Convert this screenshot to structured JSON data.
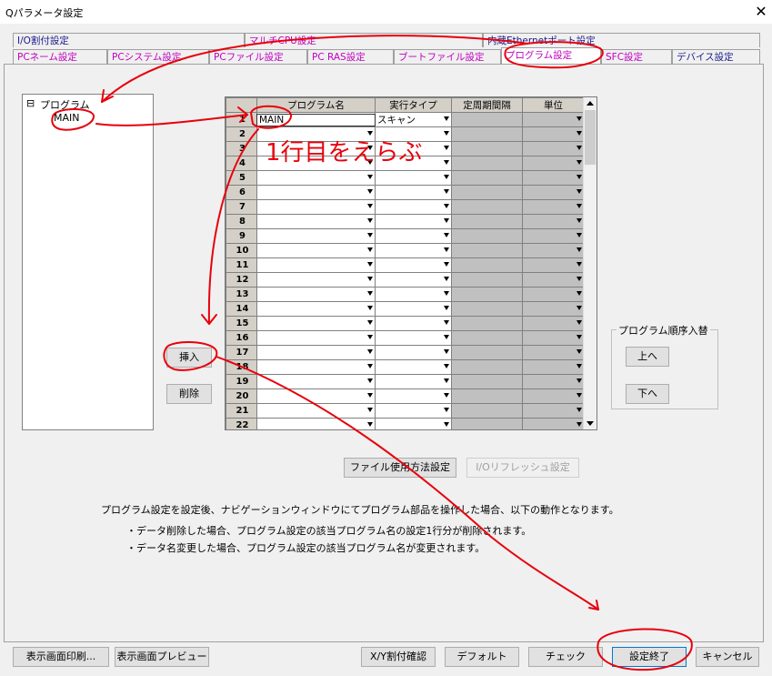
{
  "window": {
    "title": "Qパラメータ設定",
    "close_glyph": "✕"
  },
  "tabs_row1": [
    "I/O割付設定",
    "マルチCPU設定",
    "内蔵Ethernetポート設定"
  ],
  "tabs_row2": [
    "PCネーム設定",
    "PCシステム設定",
    "PCファイル設定",
    "PC RAS設定",
    "ブートファイル設定",
    "プログラム設定",
    "SFC設定",
    "デバイス設定"
  ],
  "tree": {
    "root_toggle": "⊟",
    "root": "プログラム",
    "child": "MAIN"
  },
  "buttons": {
    "insert": "挿入",
    "delete": "削除",
    "up": "上へ",
    "down": "下へ",
    "file_usage": "ファイル使用方法設定",
    "io_refresh": "I/Oリフレッシュ設定",
    "print": "表示画面印刷...",
    "preview": "表示画面プレビュー",
    "xy": "X/Y割付確認",
    "default": "デフォルト",
    "check": "チェック",
    "finish": "設定終了",
    "cancel": "キャンセル"
  },
  "order_group_label": "プログラム順序入替",
  "grid": {
    "headers": [
      "",
      "プログラム名",
      "実行タイプ",
      "定周期間隔",
      "単位"
    ],
    "rows": [
      {
        "num": "1",
        "name": "MAIN",
        "type": "スキャン"
      },
      {
        "num": "2",
        "name": "",
        "type": ""
      },
      {
        "num": "3",
        "name": "",
        "type": ""
      },
      {
        "num": "4",
        "name": "",
        "type": ""
      },
      {
        "num": "5",
        "name": "",
        "type": ""
      },
      {
        "num": "6",
        "name": "",
        "type": ""
      },
      {
        "num": "7",
        "name": "",
        "type": ""
      },
      {
        "num": "8",
        "name": "",
        "type": ""
      },
      {
        "num": "9",
        "name": "",
        "type": ""
      },
      {
        "num": "10",
        "name": "",
        "type": ""
      },
      {
        "num": "11",
        "name": "",
        "type": ""
      },
      {
        "num": "12",
        "name": "",
        "type": ""
      },
      {
        "num": "13",
        "name": "",
        "type": ""
      },
      {
        "num": "14",
        "name": "",
        "type": ""
      },
      {
        "num": "15",
        "name": "",
        "type": ""
      },
      {
        "num": "16",
        "name": "",
        "type": ""
      },
      {
        "num": "17",
        "name": "",
        "type": ""
      },
      {
        "num": "18",
        "name": "",
        "type": ""
      },
      {
        "num": "19",
        "name": "",
        "type": ""
      },
      {
        "num": "20",
        "name": "",
        "type": ""
      },
      {
        "num": "21",
        "name": "",
        "type": ""
      },
      {
        "num": "22",
        "name": "",
        "type": ""
      }
    ]
  },
  "notes": {
    "main": "プログラム設定を設定後、ナビゲーションウィンドウにてプログラム部品を操作した場合、以下の動作となります。",
    "bullet1": "・データ削除した場合、プログラム設定の該当プログラム名の設定1行分が削除されます。",
    "bullet2": "・データ名変更した場合、プログラム設定の該当プログラム名が変更されます。"
  },
  "annotation": {
    "handwritten": "1行目をえらぶ",
    "color": "#e8000b"
  },
  "colors": {
    "tab_blue": "#1a1a8c",
    "tab_magenta": "#c000c0",
    "grid_header": "#d4d0c8",
    "grid_disabled": "#c0c0c0"
  }
}
